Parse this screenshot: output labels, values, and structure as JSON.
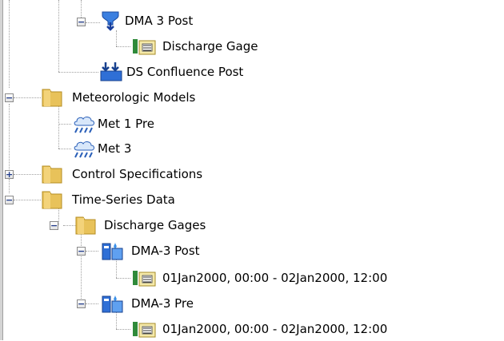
{
  "tree": {
    "dma3_post": {
      "label": "DMA 3 Post",
      "icon": "sink-icon"
    },
    "discharge_gage": {
      "label": "Discharge Gage",
      "icon": "gage-icon"
    },
    "ds_confluence_post": {
      "label": "DS Confluence Post",
      "icon": "junction-icon"
    },
    "meteorologic_models": {
      "label": "Meteorologic Models",
      "icon": "folder-icon"
    },
    "met1_pre": {
      "label": "Met 1 Pre",
      "icon": "weather-icon"
    },
    "met3": {
      "label": "Met 3",
      "icon": "weather-icon"
    },
    "control_specifications": {
      "label": "Control Specifications",
      "icon": "folder-icon"
    },
    "time_series_data": {
      "label": "Time-Series Data",
      "icon": "folder-icon"
    },
    "discharge_gages": {
      "label": "Discharge Gages",
      "icon": "folder-icon"
    },
    "dma3_post_gage": {
      "label": "DMA-3 Post",
      "icon": "gage-station-icon"
    },
    "dma3_post_window": {
      "label": "01Jan2000, 00:00 - 02Jan2000, 12:00",
      "icon": "gage-icon"
    },
    "dma3_pre_gage": {
      "label": "DMA-3 Pre",
      "icon": "gage-station-icon"
    },
    "dma3_pre_window": {
      "label": "01Jan2000, 00:00 - 02Jan2000, 12:00",
      "icon": "gage-icon"
    }
  },
  "toggles": {
    "expanded": "−",
    "collapsed": "+"
  },
  "colors": {
    "folder": "#e8c25a",
    "tree_line": "#a0a0a0",
    "icon_blue": "#1a5fd0"
  }
}
